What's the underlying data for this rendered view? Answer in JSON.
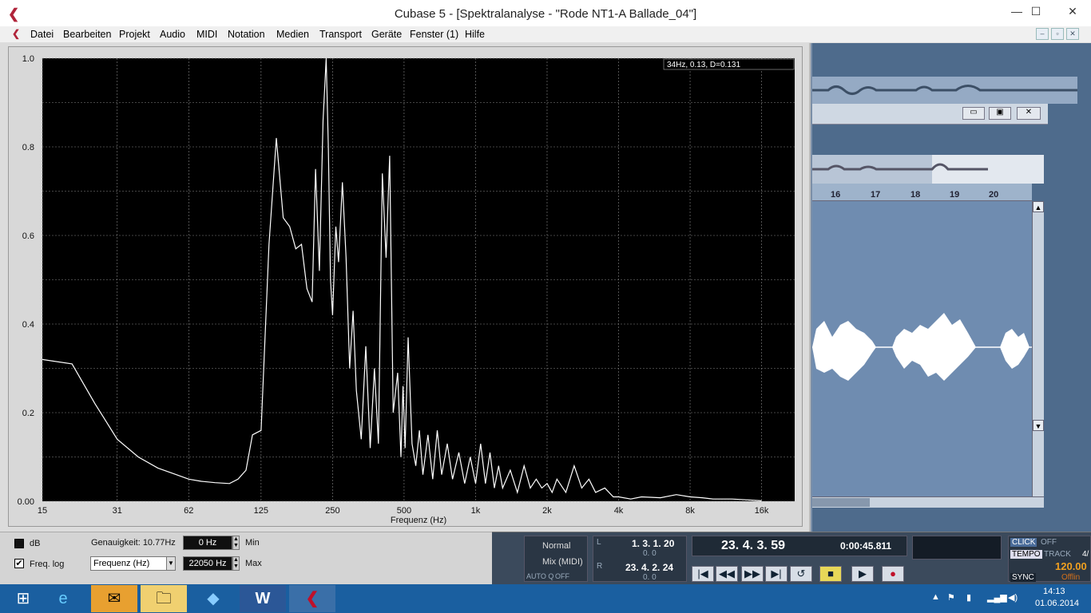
{
  "window": {
    "title": "Cubase 5 - [Spektralanalyse - \"Rode NT1-A Ballade_04\"]",
    "minimize": "—",
    "maximize": "☐",
    "close": "✕"
  },
  "menu": [
    "Datei",
    "Bearbeiten",
    "Projekt",
    "Audio",
    "MIDI",
    "Notation",
    "Medien",
    "Transport",
    "Geräte",
    "Fenster (1)",
    "Hilfe"
  ],
  "mdi_buttons": {
    "minimize": "–",
    "restore": "▫",
    "close": "✕"
  },
  "readout": "34Hz, 0.13, D=0.131",
  "chart_data": {
    "type": "line",
    "xlabel": "Frequenz (Hz)",
    "ylabel": "",
    "xscale": "log",
    "xticks": [
      "15",
      "31",
      "62",
      "125",
      "250",
      "500",
      "1k",
      "2k",
      "4k",
      "8k",
      "16k"
    ],
    "yticks": [
      "0.00",
      "0.2",
      "0.4",
      "0.6",
      "0.8",
      "1.0"
    ],
    "ylim": [
      0,
      1.0
    ],
    "xlim": [
      15,
      22050
    ],
    "grid": true,
    "series": [
      {
        "x": [
          15,
          20,
          25,
          31,
          38,
          46,
          55,
          62,
          70,
          80,
          92,
          100,
          108,
          115,
          125,
          135,
          145,
          155,
          165,
          175,
          185,
          195,
          205,
          212,
          220,
          228,
          235,
          240,
          245,
          250,
          258,
          265,
          275,
          285,
          295,
          305,
          315,
          330,
          345,
          360,
          375,
          390,
          405,
          420,
          435,
          450,
          470,
          485,
          495,
          505,
          520,
          540,
          560,
          580,
          600,
          630,
          660,
          690,
          720,
          760,
          800,
          850,
          900,
          950,
          1000,
          1050,
          1100,
          1150,
          1200,
          1250,
          1300,
          1400,
          1500,
          1600,
          1700,
          1800,
          1900,
          2000,
          2100,
          2200,
          2400,
          2600,
          2800,
          3000,
          3200,
          3500,
          3800,
          4000,
          4500,
          5000,
          6000,
          7000,
          8000,
          9000,
          10000,
          12000,
          14000,
          16000
        ],
        "y": [
          0.32,
          0.31,
          0.22,
          0.14,
          0.1,
          0.075,
          0.06,
          0.05,
          0.045,
          0.042,
          0.04,
          0.05,
          0.07,
          0.15,
          0.16,
          0.58,
          0.82,
          0.64,
          0.62,
          0.57,
          0.58,
          0.48,
          0.45,
          0.75,
          0.52,
          0.86,
          1.0,
          0.8,
          0.5,
          0.42,
          0.62,
          0.54,
          0.72,
          0.55,
          0.3,
          0.43,
          0.25,
          0.14,
          0.35,
          0.12,
          0.3,
          0.13,
          0.74,
          0.55,
          0.78,
          0.2,
          0.29,
          0.1,
          0.26,
          0.12,
          0.37,
          0.13,
          0.08,
          0.16,
          0.06,
          0.15,
          0.05,
          0.16,
          0.06,
          0.13,
          0.05,
          0.11,
          0.04,
          0.1,
          0.04,
          0.13,
          0.04,
          0.11,
          0.03,
          0.08,
          0.03,
          0.07,
          0.02,
          0.08,
          0.03,
          0.05,
          0.03,
          0.04,
          0.02,
          0.05,
          0.02,
          0.08,
          0.03,
          0.05,
          0.02,
          0.03,
          0.01,
          0.01,
          0.005,
          0.01,
          0.008,
          0.015,
          0.01,
          0.008,
          0.005,
          0.005,
          0.003,
          0.001
        ]
      }
    ]
  },
  "controls": {
    "db_label": "dB",
    "freqlog_label": "Freq. log",
    "accuracy_label": "Genauigkeit: 10.77Hz",
    "min_value": "0 Hz",
    "min_label": "Min",
    "max_value": "22050 Hz",
    "max_label": "Max",
    "mode_value": "Frequenz (Hz)"
  },
  "right_panel": {
    "ruler": [
      "16",
      "17",
      "18",
      "19",
      "20"
    ],
    "scroll_up": "▲",
    "scroll_down": "▼"
  },
  "transport": {
    "mode": "Normal",
    "mix": "Mix (MIDI)",
    "autoq_label": "AUTO Q",
    "autoq_value": "OFF",
    "left_locator": "1. 3. 1. 20",
    "left_sub": "0.   0",
    "right_locator": "23. 4. 2. 24",
    "right_sub": "0.   0",
    "l_label": "L",
    "r_label": "R",
    "position": "23. 4. 3. 59",
    "time": "0:00:45.811",
    "click_label": "CLICK",
    "click_value": "OFF",
    "tempo_label": "TEMPO",
    "track_label": "TRACK",
    "track_value": "4/",
    "tempo_value": "120.00",
    "sync_label": "SYNC",
    "sync_value": "Offlin",
    "buttons": [
      "|◀",
      "◀◀",
      "▶▶",
      "▶|",
      "↺",
      "■",
      "▶",
      "●"
    ]
  },
  "tray": {
    "time": "14:13",
    "date": "01.06.2014"
  },
  "colors": {
    "accent": "#b0243a",
    "plot_bg": "#000000",
    "curve": "#ffffff",
    "taskbar": "#1a5fa0"
  }
}
